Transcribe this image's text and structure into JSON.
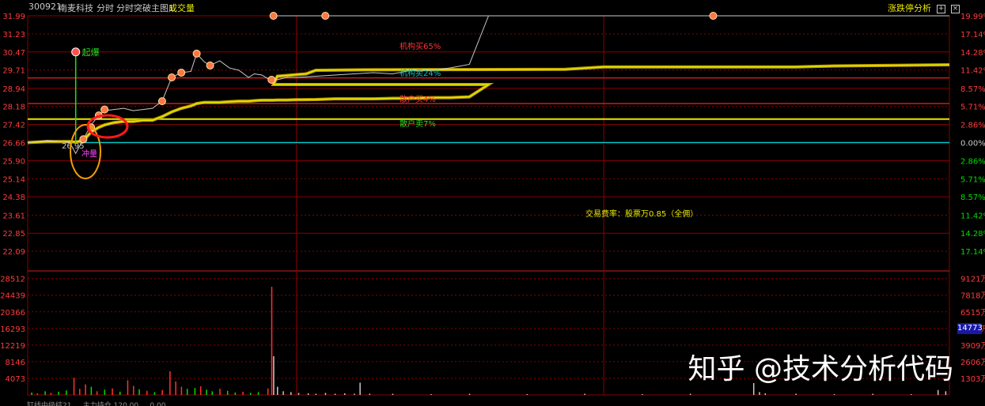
{
  "header": {
    "code": "300921",
    "name": "南麦科技",
    "mode": "分时",
    "indicator": "分时突破主图1",
    "volume_label": "成交量",
    "right_title": "涨跌停分析",
    "btn_plus": "+",
    "btn_x": "×"
  },
  "colors": {
    "up": "#ff3333",
    "down": "#00dd00",
    "grid": "#8b0000",
    "price_line": "#c8c8c8",
    "avg_line": "#e8e800",
    "axis_text": "#ff3b3b",
    "ref_cyan": "#00c8c8"
  },
  "annotations": {
    "breakout": "起爆",
    "low_label": "冲量",
    "price_mark": "26.95",
    "inst_buy": "机构买65%",
    "inst_sell": "机构卖24%",
    "retail_buy": "散户买4%",
    "retail_sell": "散户卖7%",
    "fee_text": "交易费率：股票万0.85（全佣）"
  },
  "watermark": "知乎 @技术分析代码",
  "fee_box": "14773",
  "footer": "缸线中级结21 ... 主力持仓 120.00 ... 0.00",
  "chart_data": [
    {
      "type": "line",
      "title": "分时",
      "prev_close": 26.66,
      "ylim": [
        21.33,
        31.99
      ],
      "y_ticks_left": [
        "31.99",
        "31.23",
        "30.47",
        "29.71",
        "28.94",
        "28.18",
        "27.42",
        "26.66",
        "25.90",
        "25.14",
        "24.38",
        "23.61",
        "22.85",
        "22.09"
      ],
      "y_ticks_right": [
        "19.99%",
        "17.14%",
        "14.28%",
        "11.42%",
        "8.57%",
        "5.71%",
        "2.86%",
        "0.00%",
        "2.86%",
        "5.71%",
        "8.57%",
        "11.42%",
        "14.28%",
        "17.14%"
      ],
      "reference_lines": [
        {
          "name": "机构买",
          "value": 29.38
        },
        {
          "name": "散户买",
          "value": 28.3
        },
        {
          "name": "散户卖",
          "value": 27.65
        },
        {
          "name": "昨收",
          "value": 26.66
        }
      ],
      "x_minutes": [
        0,
        10,
        18,
        22,
        25,
        29,
        33,
        37,
        40,
        45,
        50,
        55,
        60,
        65,
        70,
        75,
        80,
        85,
        88,
        92,
        95,
        100,
        105,
        110,
        115,
        118,
        122,
        125,
        127,
        128,
        130,
        135,
        140,
        150,
        160,
        170,
        180,
        190,
        200,
        210,
        220,
        230,
        240
      ],
      "series": [
        {
          "values": [
            26.66,
            26.75,
            26.7,
            26.65,
            26.2,
            26.8,
            27.4,
            27.8,
            28.0,
            28.05,
            28.1,
            28.0,
            28.05,
            28.1,
            28.4,
            29.4,
            29.6,
            29.65,
            30.4,
            30.05,
            29.9,
            30.1,
            29.8,
            29.7,
            29.4,
            29.55,
            29.5,
            29.35,
            29.3,
            29.35,
            29.3,
            29.4,
            29.4,
            29.45,
            29.5,
            29.55,
            29.6,
            29.55,
            29.7,
            29.7,
            29.8,
            29.95,
            31.99
          ]
        },
        {
          "values": [
            26.66,
            26.7,
            26.7,
            26.7,
            26.68,
            26.75,
            27.1,
            27.3,
            27.4,
            27.5,
            27.55,
            27.55,
            27.6,
            27.6,
            27.75,
            27.95,
            28.1,
            28.2,
            28.3,
            28.35,
            28.35,
            28.35,
            28.38,
            28.4,
            28.4,
            28.42,
            28.44,
            28.44,
            28.44,
            28.44,
            28.45,
            28.45,
            28.46,
            28.47,
            28.5,
            28.5,
            28.5,
            28.52,
            28.52,
            28.55,
            28.55,
            28.58,
            29.1
          ]
        }
      ],
      "limit_up_segment": {
        "from_minute": 128,
        "to_minute": 240,
        "value": 31.99
      },
      "late_avg": {
        "minutes": [
          128,
          130,
          145,
          150,
          175,
          280,
          300,
          400,
          420,
          480
        ],
        "values": [
          29.1,
          29.45,
          29.55,
          29.7,
          29.72,
          29.74,
          29.84,
          29.84,
          29.88,
          29.93
        ]
      }
    },
    {
      "type": "bar",
      "title": "成交量",
      "ylim": [
        0,
        30000
      ],
      "y_ticks_left": [
        "28512",
        "24439",
        "20366",
        "16293",
        "12219",
        "8146",
        "4073"
      ],
      "y_ticks_right": [
        "9121万",
        "7818万",
        "6515万",
        "5212万",
        "3909万",
        "2606万",
        "1303万"
      ],
      "bars": [
        {
          "minute": 2,
          "value": 600,
          "dir": "down"
        },
        {
          "minute": 5,
          "value": 400,
          "dir": "up"
        },
        {
          "minute": 9,
          "value": 900,
          "dir": "down"
        },
        {
          "minute": 12,
          "value": 500,
          "dir": "up"
        },
        {
          "minute": 16,
          "value": 800,
          "dir": "down"
        },
        {
          "minute": 20,
          "value": 1100,
          "dir": "down"
        },
        {
          "minute": 24,
          "value": 4200,
          "dir": "up"
        },
        {
          "minute": 27,
          "value": 1500,
          "dir": "up"
        },
        {
          "minute": 30,
          "value": 2600,
          "dir": "up"
        },
        {
          "minute": 33,
          "value": 2000,
          "dir": "down"
        },
        {
          "minute": 36,
          "value": 900,
          "dir": "up"
        },
        {
          "minute": 40,
          "value": 1300,
          "dir": "down"
        },
        {
          "minute": 44,
          "value": 1600,
          "dir": "up"
        },
        {
          "minute": 48,
          "value": 800,
          "dir": "down"
        },
        {
          "minute": 52,
          "value": 3600,
          "dir": "up"
        },
        {
          "minute": 55,
          "value": 2200,
          "dir": "up"
        },
        {
          "minute": 58,
          "value": 1400,
          "dir": "down"
        },
        {
          "minute": 62,
          "value": 1000,
          "dir": "up"
        },
        {
          "minute": 66,
          "value": 700,
          "dir": "down"
        },
        {
          "minute": 70,
          "value": 1200,
          "dir": "up"
        },
        {
          "minute": 74,
          "value": 5800,
          "dir": "up"
        },
        {
          "minute": 77,
          "value": 3300,
          "dir": "up"
        },
        {
          "minute": 80,
          "value": 2000,
          "dir": "up"
        },
        {
          "minute": 83,
          "value": 1500,
          "dir": "down"
        },
        {
          "minute": 87,
          "value": 1700,
          "dir": "down"
        },
        {
          "minute": 90,
          "value": 2100,
          "dir": "up"
        },
        {
          "minute": 93,
          "value": 1300,
          "dir": "down"
        },
        {
          "minute": 96,
          "value": 900,
          "dir": "down"
        },
        {
          "minute": 100,
          "value": 1500,
          "dir": "up"
        },
        {
          "minute": 104,
          "value": 1000,
          "dir": "down"
        },
        {
          "minute": 108,
          "value": 600,
          "dir": "down"
        },
        {
          "minute": 112,
          "value": 800,
          "dir": "up"
        },
        {
          "minute": 116,
          "value": 500,
          "dir": "down"
        },
        {
          "minute": 120,
          "value": 700,
          "dir": "down"
        },
        {
          "minute": 125,
          "value": 1600,
          "dir": "up"
        },
        {
          "minute": 127,
          "value": 26500,
          "dir": "up"
        },
        {
          "minute": 128,
          "value": 9500,
          "dir": "neutral"
        },
        {
          "minute": 130,
          "value": 2000,
          "dir": "neutral"
        },
        {
          "minute": 133,
          "value": 900,
          "dir": "neutral"
        },
        {
          "minute": 137,
          "value": 700,
          "dir": "neutral"
        },
        {
          "minute": 141,
          "value": 500,
          "dir": "neutral"
        },
        {
          "minute": 146,
          "value": 400,
          "dir": "neutral"
        },
        {
          "minute": 150,
          "value": 300,
          "dir": "neutral"
        },
        {
          "minute": 155,
          "value": 500,
          "dir": "neutral"
        },
        {
          "minute": 160,
          "value": 300,
          "dir": "neutral"
        },
        {
          "minute": 165,
          "value": 400,
          "dir": "neutral"
        },
        {
          "minute": 170,
          "value": 300,
          "dir": "neutral"
        },
        {
          "minute": 173,
          "value": 3000,
          "dir": "neutral"
        },
        {
          "minute": 178,
          "value": 300,
          "dir": "neutral"
        },
        {
          "minute": 190,
          "value": 300,
          "dir": "neutral"
        },
        {
          "minute": 210,
          "value": 200,
          "dir": "neutral"
        },
        {
          "minute": 230,
          "value": 300,
          "dir": "neutral"
        },
        {
          "minute": 260,
          "value": 200,
          "dir": "neutral"
        },
        {
          "minute": 290,
          "value": 300,
          "dir": "neutral"
        },
        {
          "minute": 320,
          "value": 200,
          "dir": "neutral"
        },
        {
          "minute": 345,
          "value": 300,
          "dir": "neutral"
        },
        {
          "minute": 378,
          "value": 2900,
          "dir": "neutral"
        },
        {
          "minute": 381,
          "value": 700,
          "dir": "neutral"
        },
        {
          "minute": 384,
          "value": 400,
          "dir": "neutral"
        },
        {
          "minute": 400,
          "value": 300,
          "dir": "neutral"
        },
        {
          "minute": 420,
          "value": 200,
          "dir": "neutral"
        },
        {
          "minute": 440,
          "value": 300,
          "dir": "neutral"
        },
        {
          "minute": 460,
          "value": 200,
          "dir": "neutral"
        },
        {
          "minute": 474,
          "value": 1200,
          "dir": "neutral"
        },
        {
          "minute": 478,
          "value": 900,
          "dir": "neutral"
        }
      ]
    }
  ]
}
